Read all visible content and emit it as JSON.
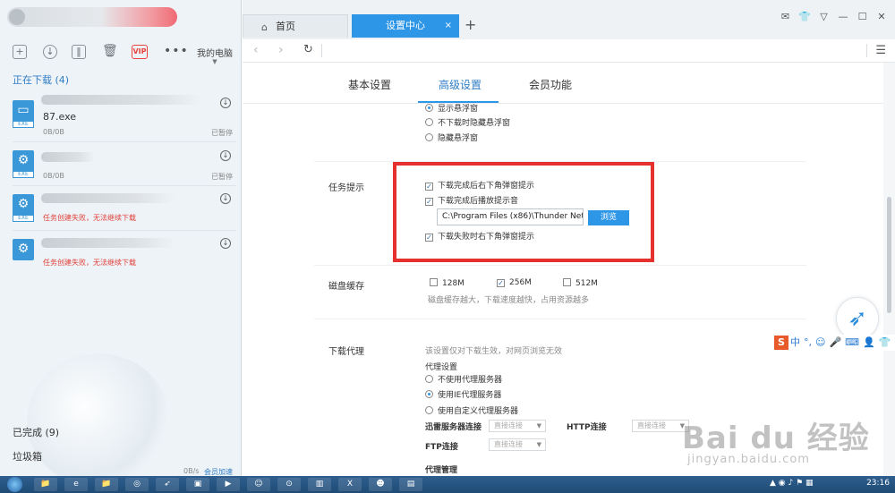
{
  "left_panel": {
    "toolbar": {
      "vip_label": "VIP",
      "more_label": "•••",
      "my_pc_label": "我的电脑"
    },
    "downloading_title": "正在下载 (4)",
    "items": [
      {
        "name": "87.exe",
        "size": "0B/0B",
        "status": "已暂停",
        "tag": "EXE",
        "error": ""
      },
      {
        "name": "",
        "size": "0B/0B",
        "status": "已暂停",
        "tag": "EXE",
        "error": ""
      },
      {
        "name": "",
        "size": "",
        "status": "",
        "tag": "EXE",
        "error": "任务创建失败，无法继续下载"
      },
      {
        "name": "",
        "size": "",
        "status": "",
        "tag": "",
        "error": "任务创建失败，无法继续下载"
      }
    ],
    "completed_label": "已完成 (9)",
    "trash_label": "垃圾箱",
    "speed_label": "0B/s",
    "accelerate_label": "会员加速"
  },
  "browser": {
    "tabs": [
      {
        "label": "首页"
      },
      {
        "label": "设置中心"
      }
    ],
    "new_tab_label": "+"
  },
  "settings": {
    "tabs": [
      "基本设置",
      "高级设置",
      "会员功能"
    ],
    "active_tab_index": 1,
    "float_window": {
      "options": [
        {
          "label": "显示悬浮窗",
          "selected": true
        },
        {
          "label": "不下载时隐藏悬浮窗",
          "selected": false
        },
        {
          "label": "隐藏悬浮窗",
          "selected": false
        }
      ]
    },
    "task_hint": {
      "label": "任务提示",
      "options": [
        {
          "label": "下载完成后右下角弹窗提示",
          "checked": true
        },
        {
          "label": "下载完成后播放提示音",
          "checked": true
        },
        {
          "label": "下载失败时右下角弹窗提示",
          "checked": true
        }
      ],
      "sound_path": "C:\\Program Files (x86)\\Thunder Net",
      "browse_label": "浏览"
    },
    "disk_cache": {
      "label": "磁盘缓存",
      "options": [
        {
          "label": "128M",
          "checked": false
        },
        {
          "label": "256M",
          "checked": true
        },
        {
          "label": "512M",
          "checked": false
        }
      ],
      "hint": "磁盘缓存越大，下载速度越快，占用资源越多"
    },
    "proxy": {
      "label": "下载代理",
      "hint": "该设置仅对下载生效，对网页浏览无效",
      "settings_title": "代理设置",
      "options": [
        {
          "label": "不使用代理服务器",
          "selected": false
        },
        {
          "label": "使用IE代理服务器",
          "selected": true
        },
        {
          "label": "使用自定义代理服务器",
          "selected": false
        }
      ],
      "thunder_conn_label": "迅雷服务器连接",
      "http_conn_label": "HTTP连接",
      "ftp_conn_label": "FTP连接",
      "select_placeholder": "直接连接",
      "manage_label": "代理管理"
    }
  },
  "ime": {
    "logo": "S",
    "mode": "中",
    "punct": "°,"
  },
  "watermark": {
    "brand": "Bai du 经验",
    "url": "jingyan.baidu.com"
  },
  "taskbar": {
    "clock": "23:16"
  },
  "colors": {
    "accent": "#2e96e6",
    "highlight_box": "#e6302d",
    "error_text": "#e0413a",
    "link_blue": "#2f7cc4"
  }
}
